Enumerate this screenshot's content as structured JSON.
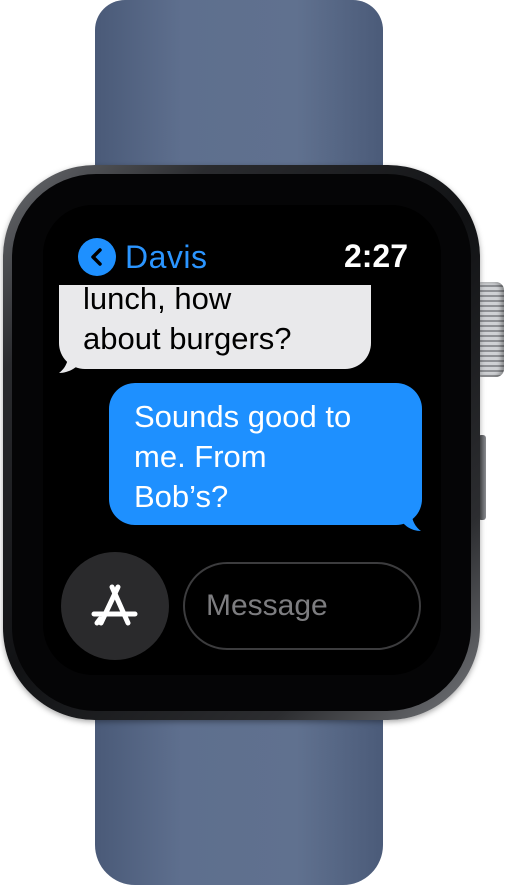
{
  "header": {
    "contact_name": "Davis",
    "time": "2:27"
  },
  "messages": [
    {
      "from": "received",
      "lines": [
        "lunch, how",
        "about burgers?"
      ]
    },
    {
      "from": "sent",
      "lines": [
        "Sounds good to",
        "me. From",
        "Bob’s?"
      ]
    }
  ],
  "composer": {
    "placeholder": "Message"
  },
  "icons": {
    "back": "chevron-left-icon",
    "apps": "app-store-icon"
  },
  "colors": {
    "accent": "#1e90ff",
    "received_bubble": "#e9e9eb",
    "band": "#5e6f8e"
  }
}
